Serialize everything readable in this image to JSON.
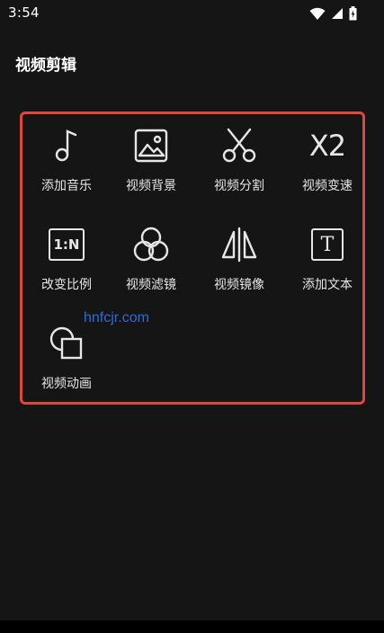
{
  "status_bar": {
    "time": "3:54",
    "icons": [
      "wifi-icon",
      "signal-icon",
      "battery-icon"
    ]
  },
  "page": {
    "title": "视频剪辑"
  },
  "tools": [
    {
      "label": "添加音乐",
      "icon": "music-note-icon"
    },
    {
      "label": "视频背景",
      "icon": "image-icon"
    },
    {
      "label": "视频分割",
      "icon": "scissors-icon"
    },
    {
      "label": "视频变速",
      "icon": "x2-speed-icon"
    },
    {
      "label": "改变比例",
      "icon": "aspect-ratio-icon",
      "icon_text": "1:N"
    },
    {
      "label": "视频滤镜",
      "icon": "filter-circles-icon"
    },
    {
      "label": "视频镜像",
      "icon": "mirror-icon"
    },
    {
      "label": "添加文本",
      "icon": "text-box-icon",
      "icon_text": "T"
    },
    {
      "label": "视频动画",
      "icon": "animation-shapes-icon"
    }
  ],
  "speed_icon_text": "X2",
  "watermark": "hnfcjr.com",
  "colors": {
    "background": "#151515",
    "panel_border": "#e0473c",
    "watermark": "#2f6bd8"
  }
}
